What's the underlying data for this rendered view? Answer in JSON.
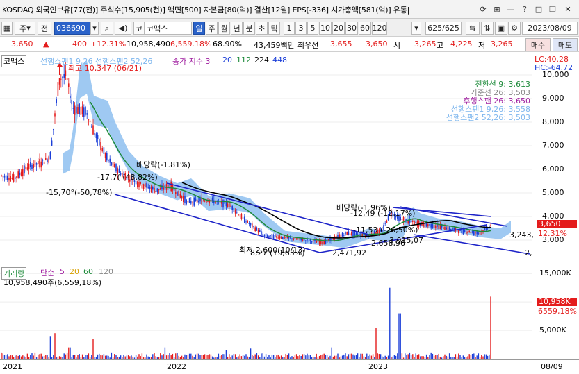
{
  "titlebar": {
    "text": "KOSDAQ 외국인보유[77(천)] 주식수[15,905(천)] 액면[500] 자본금[80(억)] 결산[12월] EPS[-336] 시가총액[581(억)] 유통|"
  },
  "toolbar": {
    "stock_code": "036690",
    "stock_name": "코맥스",
    "prefix_ju": "주",
    "prefix_jeon": "전",
    "code_prefix": "코",
    "period_buttons": [
      "일",
      "주",
      "월",
      "년",
      "분",
      "초",
      "틱"
    ],
    "interval_buttons": [
      "1",
      "3",
      "5",
      "10",
      "20",
      "30",
      "60",
      "120"
    ],
    "count": "625/625",
    "date": "2023/08/09"
  },
  "quote": {
    "price": "3,650",
    "change": "400",
    "change_pct": "+12.31%",
    "volume": "10,958,490",
    "volume_pct": "6,559.18%",
    "turnover_pct": "68.90%",
    "amount": "43,459백만",
    "priority_label": "최우선",
    "ask": "3,655",
    "bid": "3,650",
    "open_label": "시",
    "open": "3,265",
    "high_label": "고",
    "high": "4,225",
    "low_label": "저",
    "low": "3,265",
    "sell_label": "매수",
    "buy_label": "매도"
  },
  "legend": {
    "name": "코맥스",
    "span": "선행스팬1 9,26 선행스팬2 52,26",
    "ma": "종가 지수 3",
    "ma_values": [
      "20",
      "112",
      "224",
      "448"
    ],
    "lc": "LC:40.28",
    "hc": "HC:-64.72"
  },
  "ichimoku": [
    {
      "label": "전환선 9: 3,613",
      "color": "#1d8a3a"
    },
    {
      "label": "기준선 26: 3,503",
      "color": "#888888"
    },
    {
      "label": "후행스팬 26: 3,650",
      "color": "#a020a0"
    },
    {
      "label": "선행스팬1 9,26: 3,558",
      "color": "#7fb7ee"
    },
    {
      "label": "선행스팬2 52,26: 3,503",
      "color": "#7fb7ee"
    }
  ],
  "annotations": {
    "high": "최고 10,347 (06/21)",
    "div1": "배당락(-1.81%)",
    "pct1": "-17.7( (48.82%)",
    "pct2": "-15,70°(-50,78%)",
    "low": "최저 2,600(10/13)",
    "low_pct": "8,27 (19,63%)",
    "val2471": "2,471,92",
    "val2658": "2,658,96",
    "val3015": "3,015,07",
    "div2": "배당락(-1.96%)",
    "seg1": "-12,49 (-12,17%)",
    "seg2": "-11,53 (-26,50%)",
    "right_val": "3,243,",
    "right_val2": "2,"
  },
  "price_axis": [
    "10,000",
    "9,000",
    "8,000",
    "7,000",
    "6,000",
    "5,000",
    "4,000",
    "3,000"
  ],
  "price_tag": {
    "price": "3,650",
    "pct": "12.31%"
  },
  "volume_legend": {
    "label": "거래량",
    "simple": "단순",
    "periods": [
      "5",
      "20",
      "60",
      "120"
    ],
    "value": "10,958,490주(6,559,18%)"
  },
  "volume_axis": [
    "15,000K",
    "10,000K",
    "5,000K"
  ],
  "volume_tag": {
    "value": "10,958K",
    "pct": "6559,18%"
  },
  "x_axis": [
    "2021",
    "2022",
    "2023",
    "08/09"
  ],
  "colors": {
    "up": "#e41c1c",
    "down": "#1c3fd8",
    "cloud": "#7fb7ee"
  }
}
